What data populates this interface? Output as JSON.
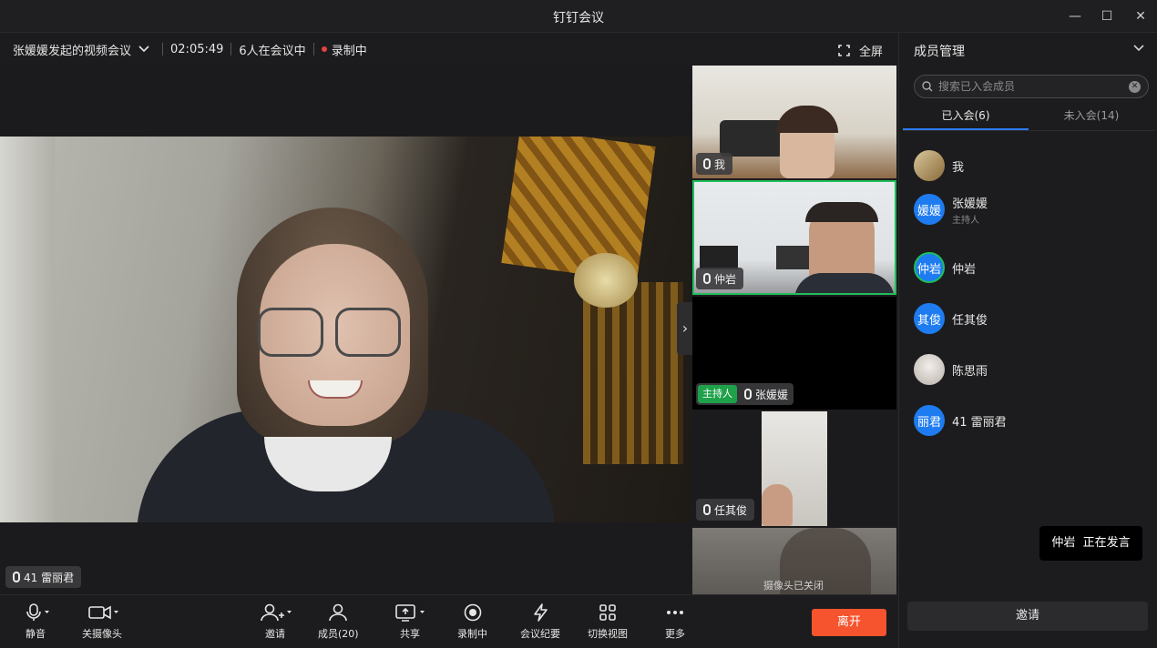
{
  "window": {
    "title": "钉钉会议"
  },
  "infobar": {
    "meeting_name": "张媛媛发起的视频会议",
    "duration": "02:05:49",
    "participants": "6人在会议中",
    "recording": "录制中",
    "fullscreen": "全屏"
  },
  "main_video": {
    "name": "41 雷丽君"
  },
  "tiles": [
    {
      "name": "我"
    },
    {
      "name": "仲岩"
    },
    {
      "host_badge": "主持人",
      "name": "张媛媛"
    },
    {
      "name": "任其俊"
    },
    {
      "status": "摄像头已关闭"
    }
  ],
  "panel": {
    "title": "成员管理",
    "search_placeholder": "搜索已入会成员",
    "tabs": [
      {
        "label": "已入会(6)"
      },
      {
        "label": "未入会(14)"
      }
    ],
    "members": [
      {
        "name": "我",
        "avatar": ""
      },
      {
        "name": "张媛媛",
        "avatar": "媛媛",
        "sub": "主持人"
      },
      {
        "name": "仲岩",
        "avatar": "仲岩"
      },
      {
        "name": "任其俊",
        "avatar": "其俊"
      },
      {
        "name": "陈思雨",
        "avatar": ""
      },
      {
        "name": "41 雷丽君",
        "avatar": "丽君"
      }
    ],
    "speaking_name": "仲岩",
    "speaking_status": "正在发言",
    "invite": "邀请"
  },
  "toolbar": {
    "mute": "静音",
    "camera": "关摄像头",
    "invite": "邀请",
    "members": "成员(20)",
    "share": "共享",
    "recording": "录制中",
    "minutes": "会议纪要",
    "switch_view": "切换视图",
    "more": "更多",
    "leave": "离开"
  },
  "colors": {
    "accent": "#2e7cf6",
    "leave": "#f5542e",
    "active_border": "#1fbf5a",
    "host_badge": "#1fa14a"
  }
}
